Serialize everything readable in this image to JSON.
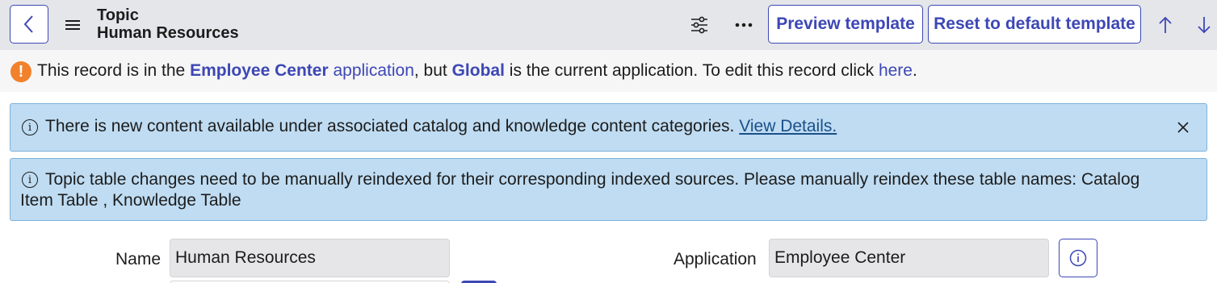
{
  "header": {
    "title_line1": "Topic",
    "title_line2": "Human Resources",
    "preview_label": "Preview template",
    "reset_label": "Reset to default template",
    "icons": [
      "back-icon",
      "hamburger-icon",
      "settings-sliders-icon",
      "more-icon",
      "arrow-up-icon",
      "arrow-down-icon"
    ]
  },
  "warning": {
    "part1": "This record is in the ",
    "app_name": "Employee Center",
    "part2": " application",
    "part3": ", but ",
    "current_app": "Global",
    "part4": " is the current application. To edit this record click ",
    "link": "here",
    "part5": "."
  },
  "info_messages": {
    "msg1_text": "There is new content available under associated catalog and knowledge content categories. ",
    "msg1_link": "View Details.",
    "msg2_text": "Topic table changes need to be manually reindexed for their corresponding indexed sources. Please manually reindex these table names: Catalog Item Table , Knowledge Table"
  },
  "form": {
    "name_label": "Name",
    "name_value": "Human Resources",
    "application_label": "Application",
    "application_value": "Employee Center"
  },
  "colors": {
    "accent": "#3d47b5",
    "warning": "#f2812b",
    "info_bg": "#bfdcf2",
    "header_bg": "#e4e6ea"
  }
}
